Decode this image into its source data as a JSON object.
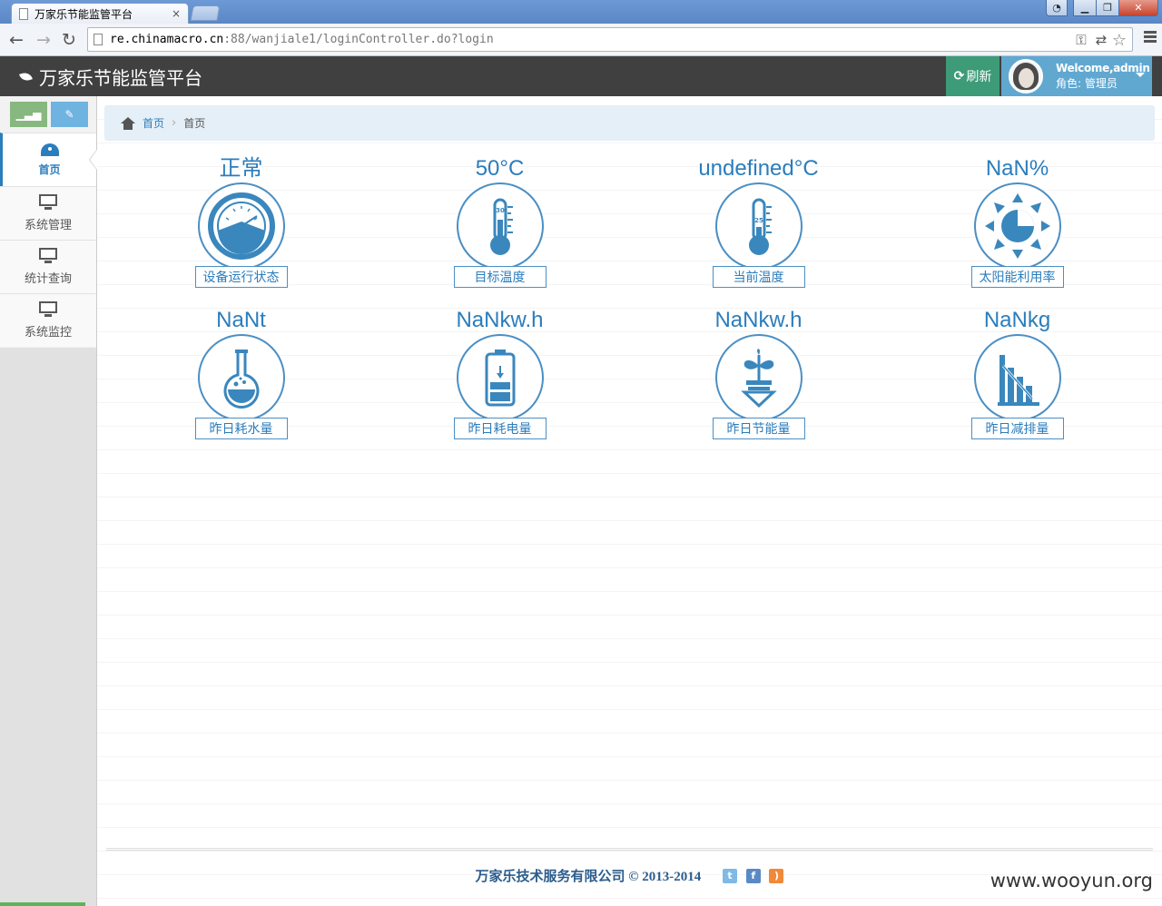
{
  "browser": {
    "tab_title": "万家乐节能监管平台",
    "tab_close": "×",
    "url_host": "re.chinamacro.cn",
    "url_path": ":88/wanjiale1/loginController.do?login"
  },
  "header": {
    "brand": "万家乐节能监管平台",
    "refresh_label": "刷新",
    "welcome": "Welcome,admin",
    "role": "角色: 管理员"
  },
  "sidebar": {
    "items": [
      {
        "label": "首页",
        "icon": "dashboard-icon",
        "active": true
      },
      {
        "label": "系统管理",
        "icon": "monitor-icon"
      },
      {
        "label": "统计查询",
        "icon": "monitor-icon"
      },
      {
        "label": "系统监控",
        "icon": "monitor-icon"
      }
    ]
  },
  "breadcrumb": {
    "home": "首页",
    "current": "首页"
  },
  "tiles": [
    {
      "value": "正常",
      "caption": "设备运行状态",
      "icon": "gauge-icon"
    },
    {
      "value": "50°C",
      "caption": "目标温度",
      "icon": "thermometer-icon",
      "mark": "30"
    },
    {
      "value": "undefined°C",
      "caption": "当前温度",
      "icon": "thermometer-icon",
      "mark": "25"
    },
    {
      "value": "NaN%",
      "caption": "太阳能利用率",
      "icon": "sun-icon"
    },
    {
      "value": "NaNt",
      "caption": "昨日耗水量",
      "icon": "flask-icon"
    },
    {
      "value": "NaNkw.h",
      "caption": "昨日耗电量",
      "icon": "battery-icon"
    },
    {
      "value": "NaNkw.h",
      "caption": "昨日节能量",
      "icon": "plant-icon"
    },
    {
      "value": "NaNkg",
      "caption": "昨日减排量",
      "icon": "bar-chart-icon"
    }
  ],
  "footer": {
    "text": "万家乐技术服务有限公司 © 2013-2014"
  },
  "watermark": "www.wooyun.org",
  "colors": {
    "accent": "#2b7dbc",
    "header_bg": "#404040",
    "refresh_bg": "#3d9b78",
    "user_bg": "#61a8d1"
  }
}
